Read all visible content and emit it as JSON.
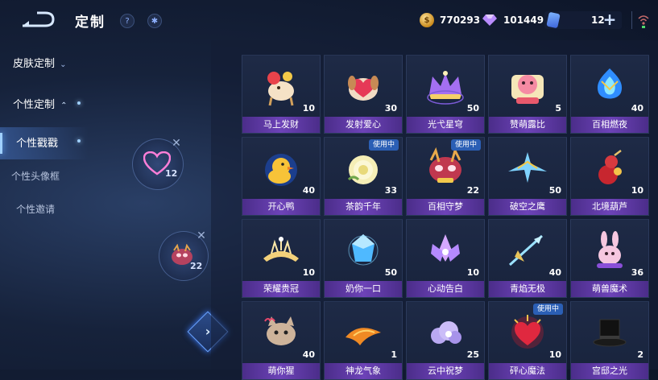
{
  "header": {
    "title": "定制",
    "gold": "770293",
    "diamonds": "101449",
    "tickets": "12",
    "plus": "+"
  },
  "sidebar": {
    "items": [
      {
        "label": "皮肤定制"
      },
      {
        "label": "个性定制"
      },
      {
        "label": "个性戳戳"
      },
      {
        "label": "个性头像框"
      },
      {
        "label": "个性邀请"
      }
    ],
    "slots": [
      {
        "count": "12"
      },
      {
        "count": "22"
      }
    ],
    "expand": "›"
  },
  "colors": {
    "label_bar": "#6d43b8",
    "accent": "#9fd0ff",
    "badge": "#2b5fb5"
  },
  "items": [
    {
      "name": "马上发财",
      "count": "10",
      "icon": "horse-icon",
      "badge": ""
    },
    {
      "name": "发射爱心",
      "count": "30",
      "icon": "heart-dog-icon",
      "badge": ""
    },
    {
      "name": "光弋星穹",
      "count": "50",
      "icon": "crown-icon",
      "badge": ""
    },
    {
      "name": "赞萌露比",
      "count": "5",
      "icon": "ruby-icon",
      "badge": ""
    },
    {
      "name": "百相燃夜",
      "count": "40",
      "icon": "blue-flame-icon",
      "badge": ""
    },
    {
      "name": "开心鸭",
      "count": "40",
      "icon": "duck-icon",
      "badge": ""
    },
    {
      "name": "茶韵千年",
      "count": "33",
      "icon": "flower-icon",
      "badge": "使用中"
    },
    {
      "name": "百相守梦",
      "count": "22",
      "icon": "dragon-icon",
      "badge": "使用中"
    },
    {
      "name": "破空之鹰",
      "count": "50",
      "icon": "eagle-icon",
      "badge": ""
    },
    {
      "name": "北境葫芦",
      "count": "10",
      "icon": "gourd-icon",
      "badge": ""
    },
    {
      "name": "荣耀贵冠",
      "count": "10",
      "icon": "tiara-icon",
      "badge": ""
    },
    {
      "name": "奶你一口",
      "count": "50",
      "icon": "crystal-icon",
      "badge": ""
    },
    {
      "name": "心动告白",
      "count": "10",
      "icon": "lotus-icon",
      "badge": ""
    },
    {
      "name": "青焰无极",
      "count": "40",
      "icon": "spear-icon",
      "badge": ""
    },
    {
      "name": "萌兽魔术",
      "count": "36",
      "icon": "bunny-icon",
      "badge": ""
    },
    {
      "name": "萌你猩",
      "count": "40",
      "icon": "cat-icon",
      "badge": ""
    },
    {
      "name": "神龙气象",
      "count": "1",
      "icon": "fire-dragon-icon",
      "badge": ""
    },
    {
      "name": "云中祝梦",
      "count": "25",
      "icon": "cloud-icon",
      "badge": ""
    },
    {
      "name": "砰心魔法",
      "count": "10",
      "icon": "magic-heart-icon",
      "badge": "使用中"
    },
    {
      "name": "宫邸之光",
      "count": "2",
      "icon": "top-hat-icon",
      "badge": ""
    }
  ]
}
